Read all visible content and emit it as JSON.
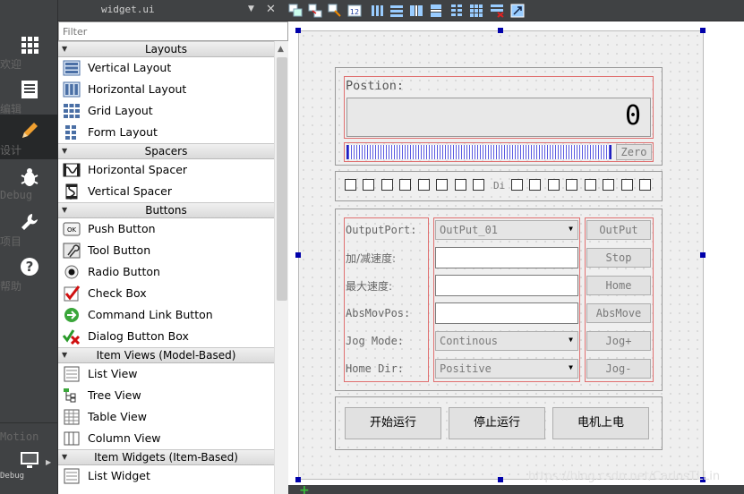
{
  "modes": [
    {
      "label": "欢迎",
      "icon": "grid-icon"
    },
    {
      "label": "编辑",
      "icon": "edit-doc-icon"
    },
    {
      "label": "设计",
      "icon": "pencil-icon"
    },
    {
      "label": "Debug",
      "icon": "bug-icon"
    },
    {
      "label": "项目",
      "icon": "wrench-icon"
    },
    {
      "label": "帮助",
      "icon": "help-icon"
    }
  ],
  "mode_bottom": {
    "project_label": "Motion",
    "build_label": "Debug"
  },
  "widgetbox": {
    "title": "widget.ui",
    "filter_placeholder": "Filter",
    "categories": {
      "layouts": "Layouts",
      "spacers": "Spacers",
      "buttons": "Buttons",
      "item_views": "Item Views (Model-Based)",
      "item_widgets": "Item Widgets (Item-Based)"
    },
    "items": {
      "vertical_layout": "Vertical Layout",
      "horizontal_layout": "Horizontal Layout",
      "grid_layout": "Grid Layout",
      "form_layout": "Form Layout",
      "horizontal_spacer": "Horizontal Spacer",
      "vertical_spacer": "Vertical Spacer",
      "push_button": "Push Button",
      "tool_button": "Tool Button",
      "radio_button": "Radio Button",
      "check_box": "Check Box",
      "command_link_button": "Command Link Button",
      "dialog_button_box": "Dialog Button Box",
      "list_view": "List View",
      "tree_view": "Tree View",
      "table_view": "Table View",
      "column_view": "Column View",
      "list_widget": "List Widget"
    }
  },
  "form": {
    "position_label": "Postion:",
    "lcd_value": "0",
    "zero_button": "Zero",
    "di_label": "Di",
    "output_port_label": "OutputPort:",
    "output_port_value": "OutPut_01",
    "accel_label": "加/减速度:",
    "max_speed_label": "最大速度:",
    "abs_pos_label": "AbsMovPos:",
    "jog_mode_label": "Jog Mode:",
    "jog_mode_value": "Continous",
    "home_dir_label": "Home Dir:",
    "home_dir_value": "Positive",
    "btn_output": "OutPut",
    "btn_stop": "Stop",
    "btn_home": "Home",
    "btn_absmove": "AbsMove",
    "btn_jog_plus": "Jog+",
    "btn_jog_minus": "Jog-",
    "btn_start": "开始运行",
    "btn_halt": "停止运行",
    "btn_motor_on": "电机上电"
  },
  "watermark": "https://blog.csdn.net/CarlosTLLin"
}
